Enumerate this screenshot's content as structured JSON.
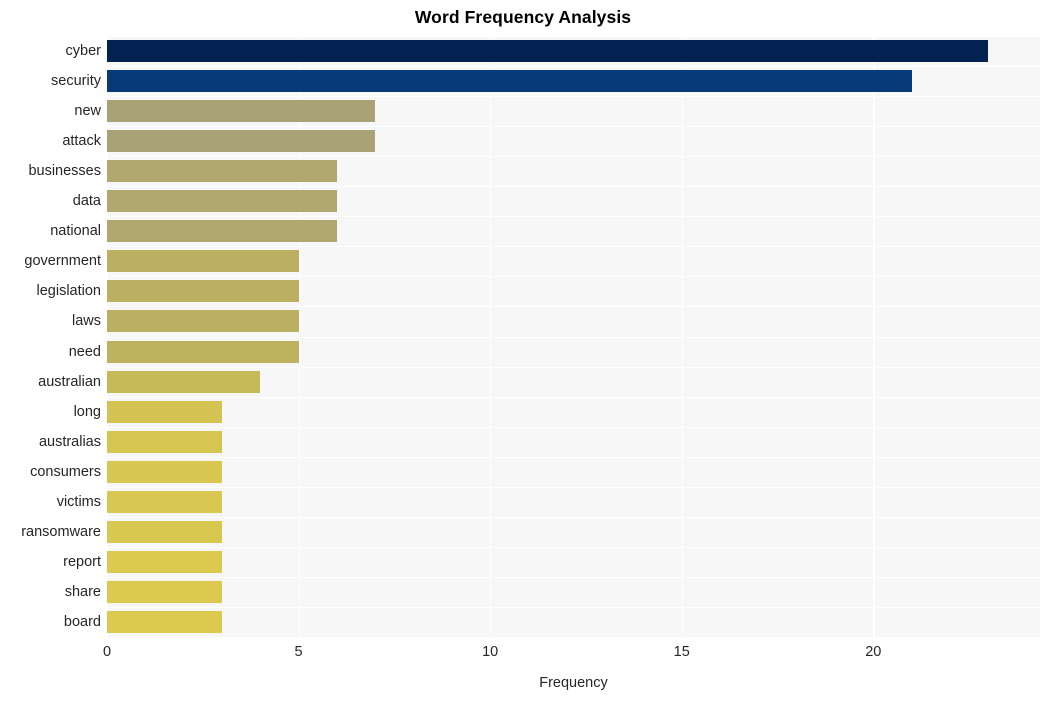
{
  "chart_data": {
    "type": "bar",
    "orientation": "horizontal",
    "title": "Word Frequency Analysis",
    "xlabel": "Frequency",
    "ylabel": "",
    "categories": [
      "cyber",
      "security",
      "new",
      "attack",
      "businesses",
      "data",
      "national",
      "government",
      "legislation",
      "laws",
      "need",
      "australian",
      "long",
      "australias",
      "consumers",
      "victims",
      "ransomware",
      "report",
      "share",
      "board"
    ],
    "values": [
      23,
      21,
      7,
      7,
      6,
      6,
      6,
      5,
      5,
      5,
      5,
      4,
      3,
      3,
      3,
      3,
      3,
      3,
      3,
      3
    ],
    "bar_colors": [
      "#022251",
      "#073a78",
      "#a9a276",
      "#a9a276",
      "#b1a86f",
      "#b1a86f",
      "#b1a870",
      "#bbb061",
      "#bbb061",
      "#bbb061",
      "#bdb25f",
      "#c6b957",
      "#d2c352",
      "#d5c551",
      "#d7c751",
      "#d8c851",
      "#d9c850",
      "#dbc950",
      "#dbc950",
      "#dbc950"
    ],
    "xticks": [
      0,
      5,
      10,
      15,
      20
    ],
    "xlim": [
      0,
      24.35
    ],
    "grid": true,
    "grid_color": "#ffffff",
    "plot_background": "#f7f7f7",
    "figure_background": "#ffffff",
    "legend": null,
    "tick_label_color": "#262626",
    "title_color": "#000000"
  }
}
